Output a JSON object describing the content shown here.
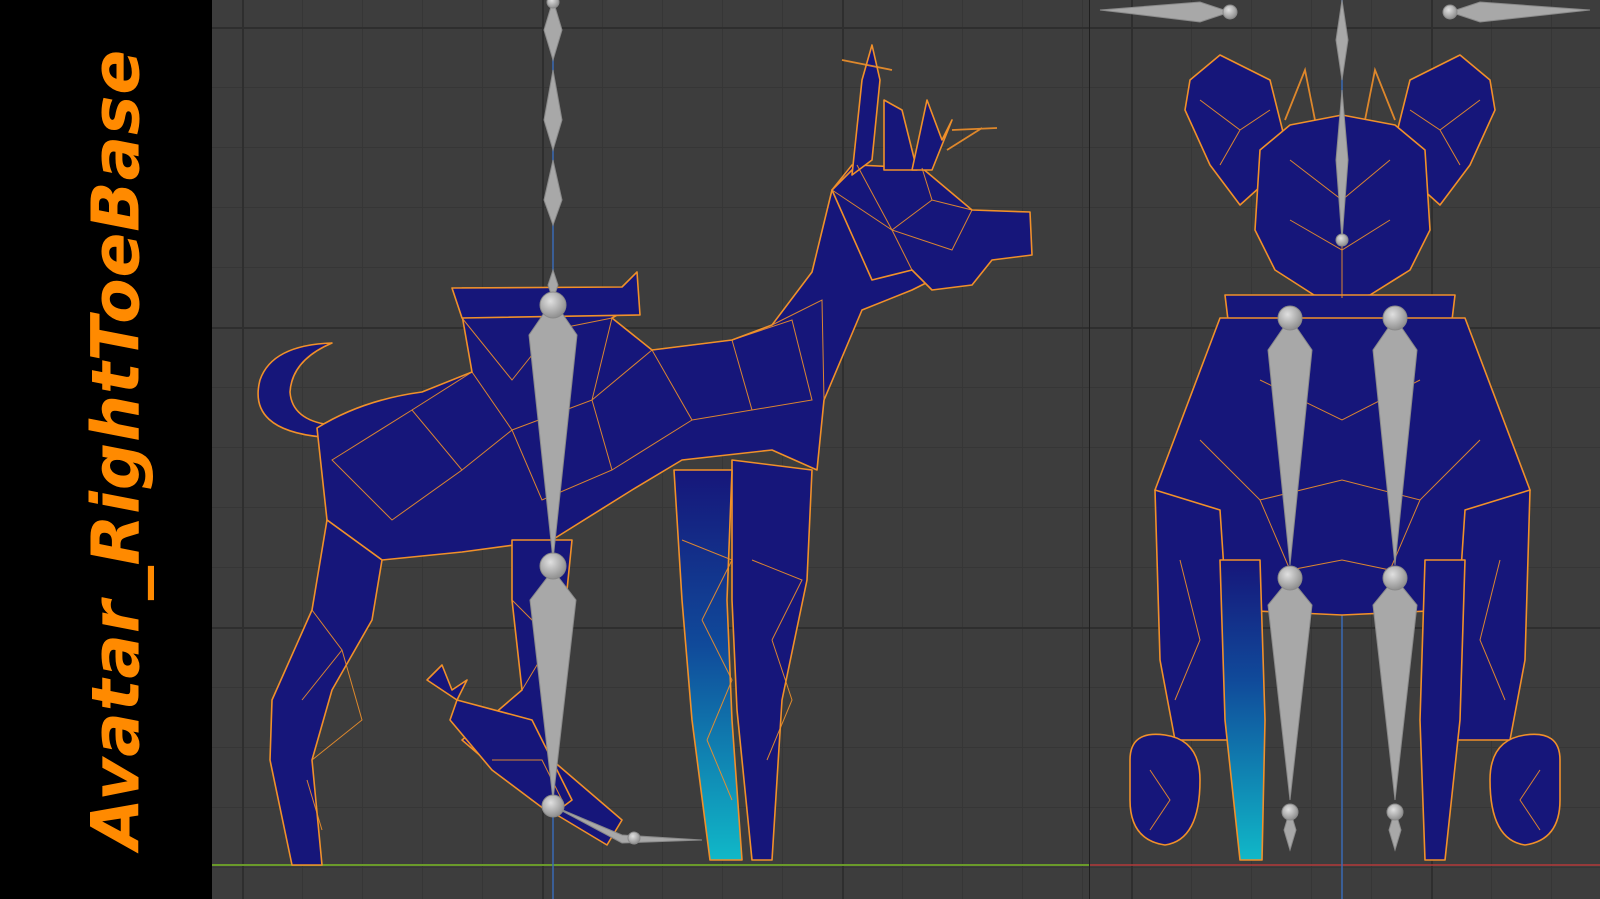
{
  "title": "Avatar_RightToeBase",
  "colors": {
    "title_text": "#ff8a00",
    "mesh_fill": "#16167a",
    "wireframe": "#f0902a",
    "bone": "#a8a8a8",
    "weight_highlight": "#10b8c8",
    "viewport_bg": "#3d3d3d",
    "ground_axis": "#6a9a2a",
    "x_axis": "#b33a3a",
    "z_axis": "#3a6ab3"
  },
  "icons": {
    "bone_joint": "sphere",
    "bone_segment": "octahedral-bone"
  }
}
